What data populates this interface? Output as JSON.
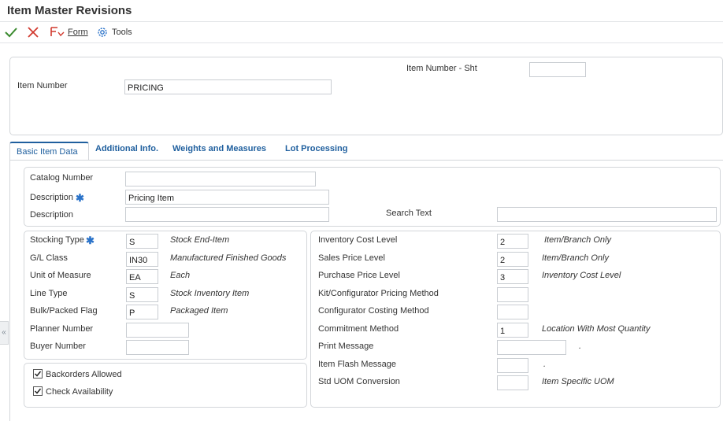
{
  "window": {
    "title": "Item Master Revisions"
  },
  "toolbar": {
    "form_label": "Form",
    "tools_label": "Tools"
  },
  "header": {
    "item_number_sht_label": "Item Number - Sht",
    "item_number_sht_value": "",
    "item_number_label": "Item Number",
    "item_number_value": "PRICING"
  },
  "tabs": [
    {
      "label": "Basic Item Data",
      "active": true
    },
    {
      "label": "Additional Info.",
      "active": false
    },
    {
      "label": "Weights and Measures",
      "active": false
    },
    {
      "label": "Lot Processing",
      "active": false
    }
  ],
  "basic": {
    "catalog_number_label": "Catalog Number",
    "catalog_number_value": "",
    "description_label": "Description",
    "description_value": "Pricing Item",
    "description2_label": "Description",
    "description2_value": "",
    "search_text_label": "Search Text",
    "search_text_value": ""
  },
  "left_fields": [
    {
      "label": "Stocking Type",
      "required": true,
      "value": "S",
      "desc": "Stock End-Item"
    },
    {
      "label": "G/L Class",
      "required": false,
      "value": "IN30",
      "desc": "Manufactured Finished Goods"
    },
    {
      "label": "Unit of Measure",
      "required": false,
      "value": "EA",
      "desc": "Each"
    },
    {
      "label": "Line Type",
      "required": false,
      "value": "S",
      "desc": "Stock Inventory Item"
    },
    {
      "label": "Bulk/Packed Flag",
      "required": false,
      "value": "P",
      "desc": "Packaged Item"
    },
    {
      "label": "Planner Number",
      "required": false,
      "value": "",
      "desc": ""
    },
    {
      "label": "Buyer Number",
      "required": false,
      "value": "",
      "desc": ""
    }
  ],
  "checkboxes": [
    {
      "label": "Backorders Allowed",
      "checked": true
    },
    {
      "label": "Check Availability",
      "checked": true
    }
  ],
  "right_fields": [
    {
      "label": "Inventory Cost Level",
      "value": "2",
      "desc": "Item/Branch Only"
    },
    {
      "label": "Sales Price Level",
      "value": "2",
      "desc": "Item/Branch Only"
    },
    {
      "label": "Purchase Price Level",
      "value": "3",
      "desc": "Inventory Cost Level"
    },
    {
      "label": "Kit/Configurator Pricing Method",
      "value": "",
      "desc": ""
    },
    {
      "label": "Configurator Costing Method",
      "value": "",
      "desc": ""
    },
    {
      "label": "Commitment Method",
      "value": "1",
      "desc": "Location With Most Quantity"
    },
    {
      "label": "Print Message",
      "value": "",
      "desc": "."
    },
    {
      "label": "Item Flash Message",
      "value": "",
      "desc": "."
    },
    {
      "label": "Std UOM Conversion",
      "value": "",
      "desc": "Item Specific UOM"
    }
  ],
  "colors": {
    "accent": "#1f5f9e",
    "ok_green": "#3a8a2e",
    "cancel_red": "#d13a2f",
    "required_star": "#2b73c9"
  },
  "icons": {
    "ok": "checkmark-icon",
    "cancel": "close-icon",
    "form": "form-icon",
    "tools": "gear-icon",
    "collapse": "chevron-double-left-icon"
  }
}
